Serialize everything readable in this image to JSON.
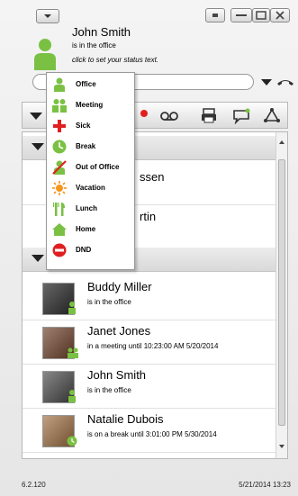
{
  "profile": {
    "name": "John Smith",
    "status": "is in the office",
    "hint": "click to set your status text."
  },
  "status_menu": {
    "items": [
      {
        "label": "Office",
        "icon": "person-green-icon"
      },
      {
        "label": "Meeting",
        "icon": "people-green-icon"
      },
      {
        "label": "Sick",
        "icon": "red-cross-icon"
      },
      {
        "label": "Break",
        "icon": "green-clock-icon"
      },
      {
        "label": "Out of Office",
        "icon": "person-slashed-icon"
      },
      {
        "label": "Vacation",
        "icon": "sun-icon"
      },
      {
        "label": "Lunch",
        "icon": "fork-knife-icon"
      },
      {
        "label": "Home",
        "icon": "house-icon"
      },
      {
        "label": "DND",
        "icon": "red-no-entry-icon"
      }
    ]
  },
  "hidden_contacts": [
    {
      "name_fragment": "ssen"
    },
    {
      "name_fragment": "rtin"
    }
  ],
  "contacts": [
    {
      "name": "Buddy Miller",
      "status": "is in the office"
    },
    {
      "name": "Janet Jones",
      "status": "in a meeting until 10:23:00 AM 5/20/2014"
    },
    {
      "name": "John Smith",
      "status": "is in the office"
    },
    {
      "name": "Natalie Dubois",
      "status": "is on a break until 3:01:00 PM 5/30/2014"
    }
  ],
  "footer": {
    "version": "6.2.120",
    "datetime": "5/21/2014 13:23"
  },
  "colors": {
    "green": "#7ac143",
    "red": "#e02020",
    "orange": "#f7941d"
  }
}
